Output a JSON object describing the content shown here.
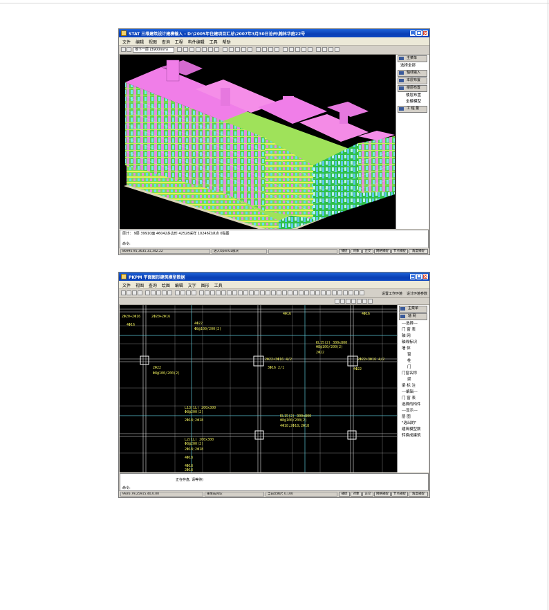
{
  "window1": {
    "title": "STAT 三维建筑设计建模输入 - D:\\2005年住建项目汇总\\2007年3月30日沧州\\翰林华庭22号",
    "menu": [
      "文件",
      "编辑",
      "视图",
      "查询",
      "工程",
      "构件编辑",
      "工具",
      "帮助"
    ],
    "floor_select": "地下一层 (3900mm)",
    "sidebar": {
      "items": [
        {
          "label": "主菜单",
          "style": "button"
        },
        {
          "label": "选择全部",
          "style": "plain"
        },
        {
          "label": "轴线输入",
          "style": "button"
        },
        {
          "label": "本层布置",
          "style": "button"
        },
        {
          "label": "楼层布置",
          "style": "button"
        },
        {
          "label": "楼层布置",
          "style": "iconitem"
        },
        {
          "label": "全楼模型",
          "style": "iconitem"
        },
        {
          "label": "工 程 量",
          "style": "button"
        }
      ]
    },
    "command_lines": [
      "层计：     9层   39910面   46042多边形   42528采样   10246打点点   0贴图",
      "命令:"
    ],
    "status": {
      "coords": "86995.95,3635.31,342.22",
      "mode": "进入OpenGL模块",
      "buttons": [
        "捕捉",
        "对象",
        "正交",
        "网格捕捉",
        "节点捕捉",
        "角度捕捉"
      ]
    }
  },
  "window2": {
    "title": "PKPM 平面图形建筑模型数据",
    "menu": [
      "文件",
      "视图",
      "查询",
      "绘图",
      "编辑",
      "文字",
      "图形",
      "工具"
    ],
    "tool_text": [
      "设置工作环境",
      "设计环境参数"
    ],
    "sidebar": {
      "items": [
        {
          "label": "主菜单",
          "style": "button"
        },
        {
          "label": "轴 网",
          "style": "button"
        },
        {
          "label": "---选择---",
          "style": "plain"
        },
        {
          "label": "门 窗 表",
          "style": "plain"
        },
        {
          "label": "轴   网",
          "style": "plain"
        },
        {
          "label": "轴线标识",
          "style": "plain"
        },
        {
          "label": "墙   体",
          "style": "plain"
        },
        {
          "label": "窗",
          "style": "indent"
        },
        {
          "label": "柱",
          "style": "indent"
        },
        {
          "label": "门",
          "style": "indent"
        },
        {
          "label": "门窗名称",
          "style": "plain"
        },
        {
          "label": "梁",
          "style": "indent"
        },
        {
          "label": "梁 标 注",
          "style": "plain"
        },
        {
          "label": "---编辑---",
          "style": "plain"
        },
        {
          "label": "门 窗 表",
          "style": "plain"
        },
        {
          "label": "选择的构件",
          "style": "plain"
        },
        {
          "label": "---显示---",
          "style": "plain"
        },
        {
          "label": "层   图",
          "style": "plain"
        },
        {
          "label": "\"选出的\"",
          "style": "plain"
        },
        {
          "label": "建筑模型数",
          "style": "plain"
        },
        {
          "label": "转换成建筑",
          "style": "plain"
        }
      ]
    },
    "labels": [
      {
        "t": "2Φ20+2Φ16"
      },
      {
        "t": "2Φ20+2Φ16"
      },
      {
        "t": "4Φ16"
      },
      {
        "t": "4Φ22"
      },
      {
        "t": "Φ8@100/200(2)"
      },
      {
        "t": "4Φ16"
      },
      {
        "t": "4Φ16"
      },
      {
        "t": "2Φ22+3Φ16 4/2"
      },
      {
        "t": "2Φ22+3Φ16 4/2"
      },
      {
        "t": "4Φ22"
      },
      {
        "t": "KL15(2) 300x800"
      },
      {
        "t": "Φ8@100/200(2)"
      },
      {
        "t": "2Φ22"
      },
      {
        "t": "2Φ22"
      },
      {
        "t": "Φ8@100/200(2)"
      },
      {
        "t": "3Φ16 2/1"
      },
      {
        "t": "L13(1L) 200x300"
      },
      {
        "t": "Φ8@200(2)"
      },
      {
        "t": "2Φ18;2Φ18"
      },
      {
        "t": "KL15(2) 300x800"
      },
      {
        "t": "Φ8@100/200(2)"
      },
      {
        "t": "4Φ18;2Φ18;2Φ18"
      },
      {
        "t": "L2(1L) 200x300"
      },
      {
        "t": "Φ8@200(2)"
      },
      {
        "t": "2Φ18;2Φ18"
      },
      {
        "t": "4Φ18"
      },
      {
        "t": "4Φ18"
      },
      {
        "t": "2Φ18"
      }
    ],
    "command_lines": [
      "正在存盘, 请等待)",
      "命令:"
    ],
    "status": {
      "coords": "9926.79,25915.40,0.00",
      "mode": "重生成完毕",
      "scale": "当前比例尺 0.100",
      "buttons": [
        "捕捉",
        "对象",
        "正交",
        "网格捕捉",
        "节点捕捉",
        "角度捕捉"
      ]
    }
  }
}
